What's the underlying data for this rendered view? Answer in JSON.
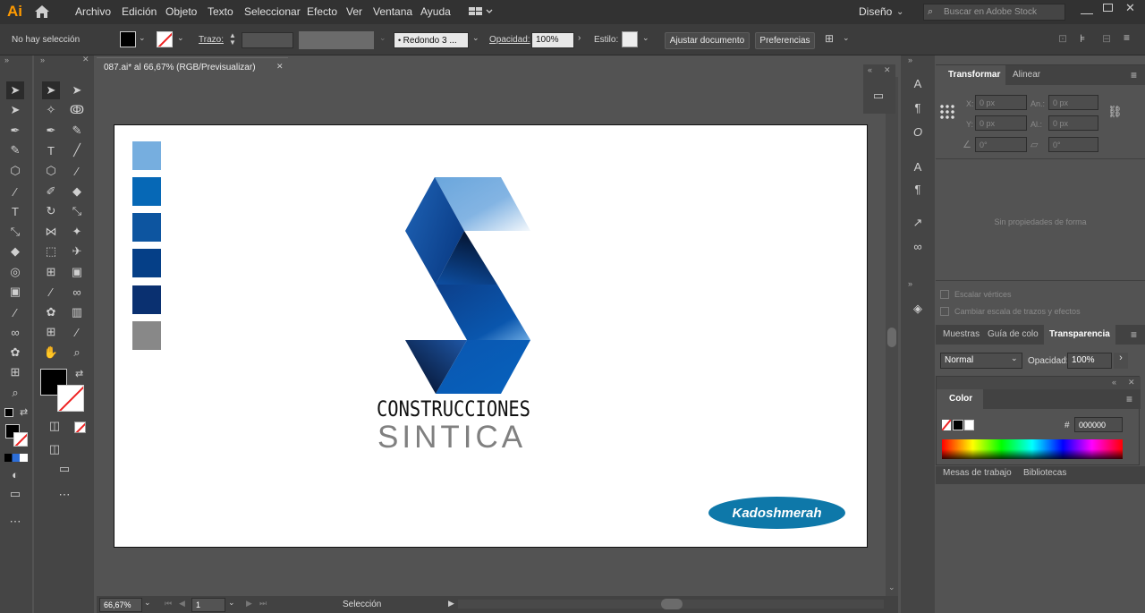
{
  "app": {
    "logo": "Ai",
    "workspace": "Diseño",
    "search_placeholder": "Buscar en Adobe Stock"
  },
  "menu": [
    "Archivo",
    "Edición",
    "Objeto",
    "Texto",
    "Seleccionar",
    "Efecto",
    "Ver",
    "Ventana",
    "Ayuda"
  ],
  "control_bar": {
    "selection_status": "No hay selección",
    "stroke_label": "Trazo:",
    "brush_value": "Redondo 3 ...",
    "opacity_label": "Opacidad:",
    "opacity_value": "100%",
    "style_label": "Estilo:",
    "doc_setup_button": "Ajustar documento",
    "prefs_button": "Preferencias"
  },
  "document": {
    "tab_title": "087.ai* al 66,67% (RGB/Previsualizar)",
    "zoom": "66,67%",
    "artboard_number": "1",
    "status_text": "Selección"
  },
  "artwork": {
    "company_line1": "CONSTRUCCIONES",
    "company_line2": "SINTICA",
    "badge_text": "Kadoshmerah",
    "swatch_colors": [
      "#76aedf",
      "#0668b6",
      "#0d55a0",
      "#053f87",
      "#0a3070",
      "#888888"
    ]
  },
  "transform_panel": {
    "tabs": [
      "Transformar",
      "Alinear"
    ],
    "x_label": "X:",
    "x_value": "0 px",
    "y_label": "Y:",
    "y_value": "0 px",
    "w_label": "An.:",
    "w_value": "0 px",
    "h_label": "Al.:",
    "h_value": "0 px",
    "angle_value": "0°",
    "shear_value": "0°",
    "empty_message": "Sin propiedades de forma",
    "scale_corners": "Escalar vértices",
    "scale_strokes": "Cambiar escala de trazos y efectos"
  },
  "transparency_panel": {
    "tabs": [
      "Muestras",
      "Guía de colo",
      "Transparencia"
    ],
    "blend_mode": "Normal",
    "opacity_label": "Opacidad:",
    "opacity_value": "100%"
  },
  "color_panel": {
    "title": "Color",
    "hex_symbol": "#",
    "hex_value": "000000"
  },
  "bottom_tabs": [
    "Mesas de trabajo",
    "Bibliotecas"
  ]
}
